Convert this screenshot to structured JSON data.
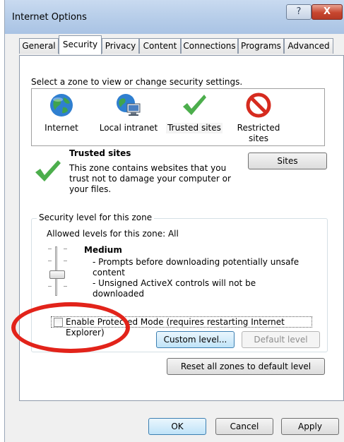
{
  "window": {
    "title": "Internet Options",
    "help_symbol": "?",
    "close_symbol": "X"
  },
  "tabs": [
    {
      "label": "General"
    },
    {
      "label": "Security",
      "active": true
    },
    {
      "label": "Privacy"
    },
    {
      "label": "Content"
    },
    {
      "label": "Connections"
    },
    {
      "label": "Programs"
    },
    {
      "label": "Advanced"
    }
  ],
  "security": {
    "zone_prompt": "Select a zone to view or change security settings.",
    "zones": [
      {
        "label": "Internet",
        "icon": "globe-icon"
      },
      {
        "label": "Local intranet",
        "icon": "intranet-icon"
      },
      {
        "label": "Trusted sites",
        "icon": "checkmark-icon",
        "selected": true
      },
      {
        "label_line1": "Restricted",
        "label_line2": "sites",
        "icon": "restricted-icon"
      }
    ],
    "selected_zone": {
      "title": "Trusted sites",
      "description": "This zone contains websites that you trust not to damage your computer or your files.",
      "icon": "checkmark-icon"
    },
    "sites_button": "Sites",
    "group_label": "Security level for this zone",
    "allowed_levels": "Allowed levels for this zone: All",
    "level": {
      "name": "Medium",
      "bullets": [
        "- Prompts before downloading potentially unsafe content",
        "- Unsigned ActiveX controls will not be downloaded"
      ]
    },
    "protected_mode": {
      "label": "Enable Protected Mode (requires restarting Internet Explorer)",
      "checked": false
    },
    "custom_level_button": "Custom level...",
    "default_level_button": "Default level",
    "reset_all_button": "Reset all zones to default level"
  },
  "footer": {
    "ok": "OK",
    "cancel": "Cancel",
    "apply": "Apply"
  },
  "colors": {
    "annotation_ring": "#e2231a",
    "accent": "#3c7fb1"
  }
}
